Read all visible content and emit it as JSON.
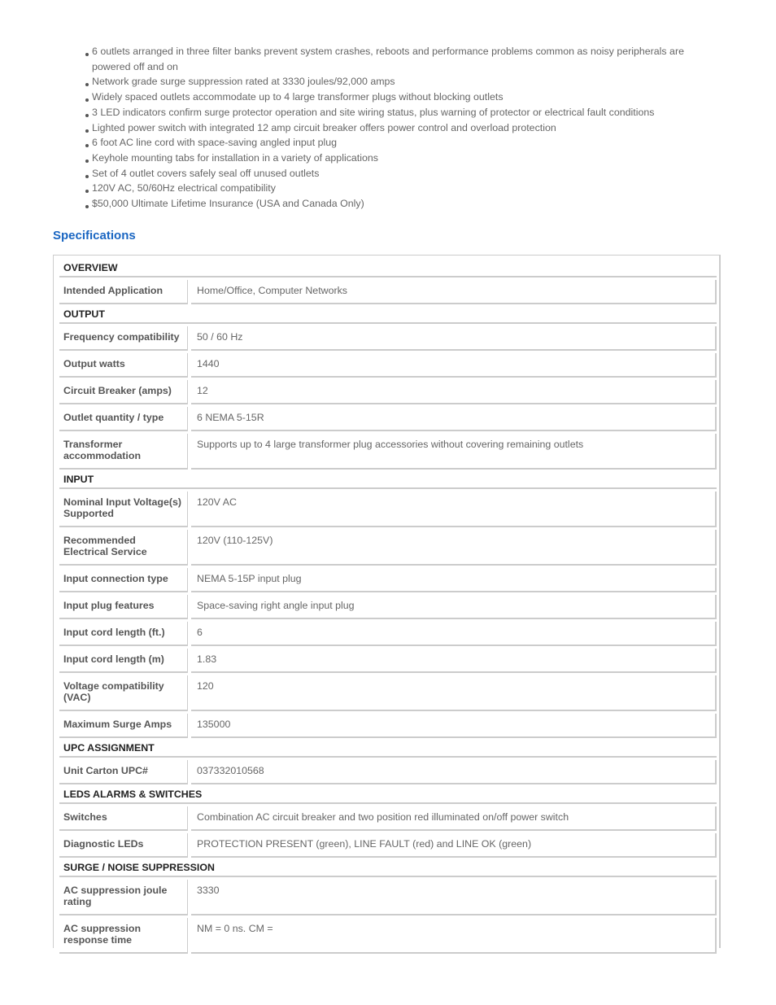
{
  "features": [
    "6 outlets arranged in three filter banks prevent system crashes, reboots and performance problems common as noisy peripherals are powered off and on",
    "Network grade surge suppression rated at 3330 joules/92,000 amps",
    "Widely spaced outlets accommodate up to 4 large transformer plugs without blocking outlets",
    "3 LED indicators confirm surge protector operation and site wiring status, plus warning of protector or electrical fault conditions",
    "Lighted power switch with integrated 12 amp circuit breaker offers power control and overload protection",
    "6 foot AC line cord with space-saving angled input plug",
    "Keyhole mounting tabs for installation in a variety of applications",
    "Set of 4 outlet covers safely seal off unused outlets",
    "120V AC, 50/60Hz electrical compatibility",
    "$50,000 Ultimate Lifetime Insurance (USA and Canada Only)"
  ],
  "specifications": {
    "title": "Specifications",
    "groups": [
      {
        "heading": "OVERVIEW",
        "rows": [
          {
            "label": "Intended Application",
            "value": "Home/Office, Computer Networks"
          }
        ]
      },
      {
        "heading": "OUTPUT",
        "rows": [
          {
            "label": "Frequency compatibility",
            "value": "50 / 60 Hz"
          },
          {
            "label": "Output watts",
            "value": "1440"
          },
          {
            "label": "Circuit Breaker (amps)",
            "value": "12"
          },
          {
            "label": "Outlet quantity / type",
            "value": "6 NEMA 5-15R"
          },
          {
            "label": "Transformer accommodation",
            "value": "Supports up to 4 large transformer plug accessories without covering remaining outlets"
          }
        ]
      },
      {
        "heading": "INPUT",
        "rows": [
          {
            "label": "Nominal Input Voltage(s) Supported",
            "value": "120V AC"
          },
          {
            "label": "Recommended Electrical Service",
            "value": "120V (110-125V)"
          },
          {
            "label": "Input connection type",
            "value": "NEMA 5-15P input plug"
          },
          {
            "label": "Input plug features",
            "value": "Space-saving right angle input plug"
          },
          {
            "label": "Input cord length (ft.)",
            "value": "6"
          },
          {
            "label": "Input cord length (m)",
            "value": "1.83"
          },
          {
            "label": "Voltage compatibility (VAC)",
            "value": "120"
          },
          {
            "label": "Maximum Surge Amps",
            "value": "135000"
          }
        ]
      },
      {
        "heading": "UPC ASSIGNMENT",
        "rows": [
          {
            "label": "Unit Carton UPC#",
            "value": "037332010568"
          }
        ]
      },
      {
        "heading": "LEDS ALARMS & SWITCHES",
        "rows": [
          {
            "label": "Switches",
            "value": "Combination AC circuit breaker and two position red illuminated on/off power switch"
          },
          {
            "label": "Diagnostic LEDs",
            "value": "PROTECTION PRESENT (green), LINE FAULT (red) and LINE OK (green)"
          }
        ]
      },
      {
        "heading": "SURGE / NOISE SUPPRESSION",
        "rows": [
          {
            "label": "AC suppression joule rating",
            "value": "3330"
          },
          {
            "label": "AC suppression response time",
            "value": "NM = 0 ns. CM ="
          }
        ]
      }
    ]
  },
  "colors": {
    "heading_blue": "#1a66c2",
    "border_gray": "#cccccc",
    "text_gray": "#666666"
  }
}
